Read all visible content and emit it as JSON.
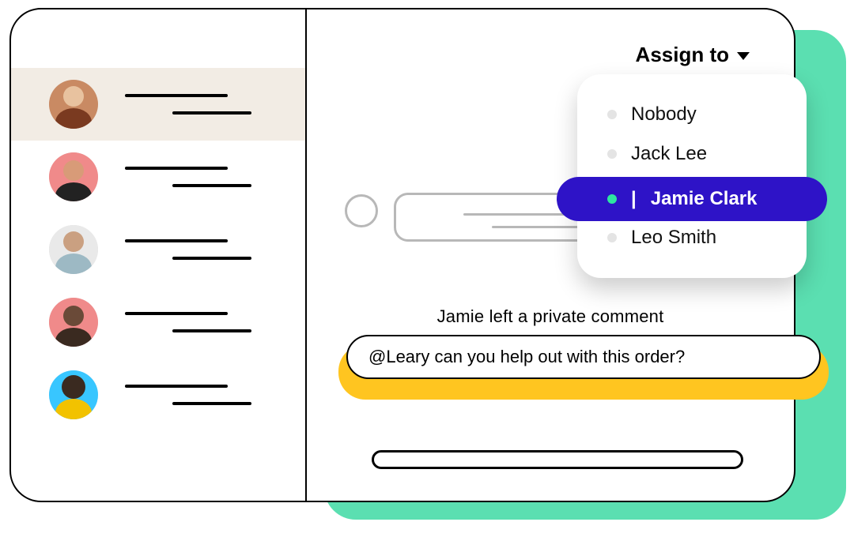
{
  "assign": {
    "trigger_label": "Assign to",
    "options": [
      "Nobody",
      "Jack Lee",
      "Jamie Clark",
      "Leo Smith"
    ],
    "selected": "Jamie Clark"
  },
  "private_comment": {
    "header": "Jamie left a private comment",
    "body": "@Leary can you help out with this order?"
  },
  "sidebar": {
    "items": [
      {
        "avatar_bg": "#c98a63",
        "shirt": "#7a3a20"
      },
      {
        "avatar_bg": "#f08a8a",
        "shirt": "#222222"
      },
      {
        "avatar_bg": "#e9e9e9",
        "shirt": "#9db9c4"
      },
      {
        "avatar_bg": "#f08a8a",
        "shirt": "#3a2a20"
      },
      {
        "avatar_bg": "#38c6ff",
        "shirt": "#f2c200"
      }
    ]
  },
  "colors": {
    "mint": "#5bdfb1",
    "indigo": "#2e13c7",
    "yellow": "#ffc520",
    "dot_active": "#2ee6a1"
  }
}
